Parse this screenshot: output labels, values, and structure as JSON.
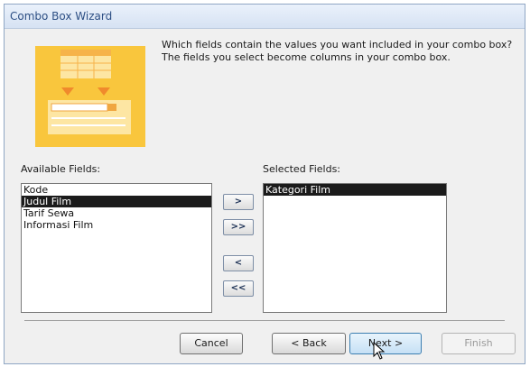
{
  "window": {
    "title": "Combo Box Wizard"
  },
  "instructions": "Which fields contain the values you want included in your combo box? The fields you select become columns in your combo box.",
  "available": {
    "label": "Available Fields:",
    "items": [
      "Kode",
      "Judul Film",
      "Tarif Sewa",
      "Informasi Film"
    ],
    "selected_index": 1
  },
  "selected": {
    "label": "Selected Fields:",
    "items": [
      "Kategori Film"
    ],
    "selected_index": 0
  },
  "move_buttons": {
    "add_one": ">",
    "add_all": ">>",
    "remove_one": "<",
    "remove_all": "<<"
  },
  "footer": {
    "cancel": "Cancel",
    "back": "< Back",
    "next": "Next >",
    "finish": "Finish"
  },
  "colors": {
    "illustration": "#f9c63d",
    "selection": "#1b1b1b"
  }
}
